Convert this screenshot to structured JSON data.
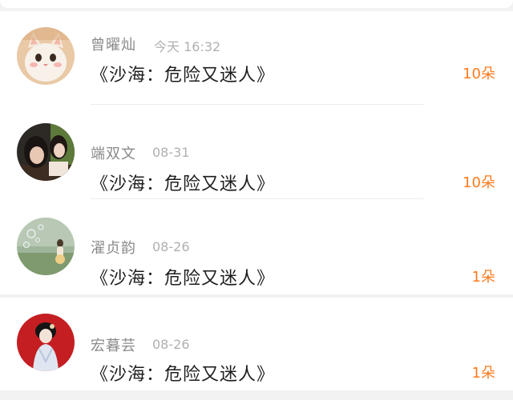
{
  "colors": {
    "accent": "#ff7a1c",
    "username": "#8a8a8a",
    "date": "#b0b0b0",
    "title": "#1e1e1e"
  },
  "entries": [
    {
      "username": "曾曜灿",
      "date": "今天 16:32",
      "title": "《沙海：危险又迷人》",
      "count": "10朵",
      "avatar_icon": "cat-avatar"
    },
    {
      "username": "端双文",
      "date": "08-31",
      "title": "《沙海：危险又迷人》",
      "count": "10朵",
      "avatar_icon": "two-girls-avatar"
    },
    {
      "username": "濯贞韵",
      "date": "08-26",
      "title": "《沙海：危险又迷人》",
      "count": "1朵",
      "avatar_icon": "bubbles-avatar"
    },
    {
      "username": "宏暮芸",
      "date": "08-26",
      "title": "《沙海：危险又迷人》",
      "count": "1朵",
      "avatar_icon": "doll-avatar"
    }
  ]
}
